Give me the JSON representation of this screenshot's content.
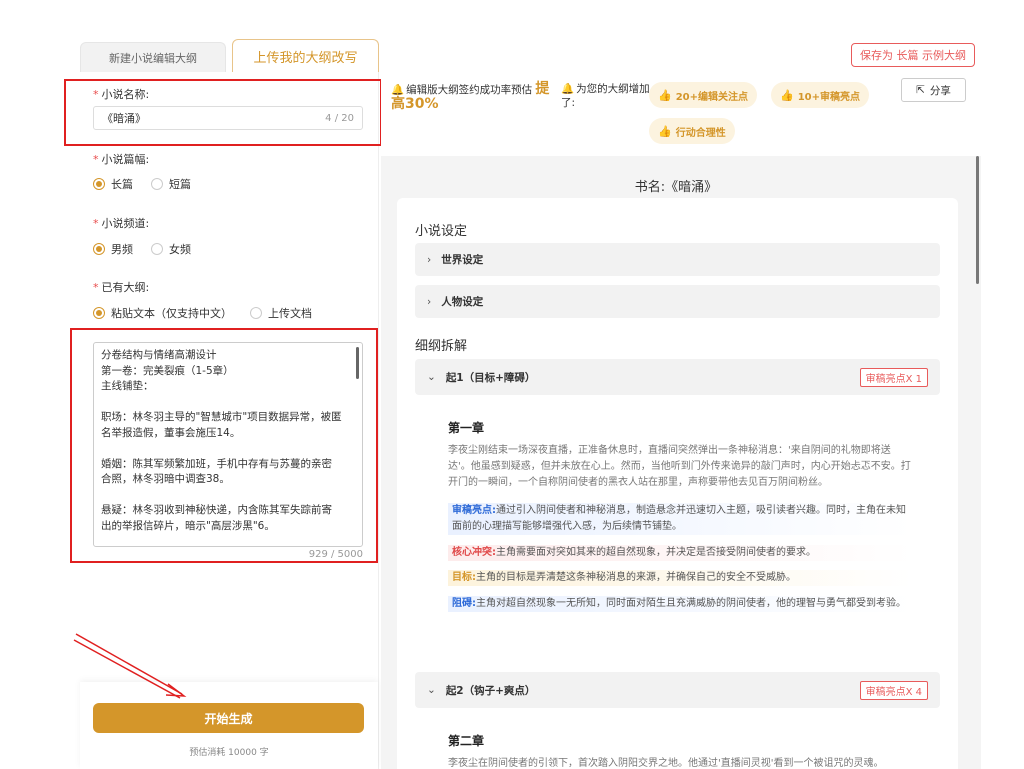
{
  "tabs": {
    "new_outline": "新建小说编辑大纲",
    "upload_outline": "上传我的大纲改写"
  },
  "save_button": "保存为 长篇 示例大纲",
  "form": {
    "novel_name": {
      "label": "小说名称:",
      "value": "《暗涌》",
      "count": "4 / 20"
    },
    "length": {
      "label": "小说篇幅:",
      "options": [
        "长篇",
        "短篇"
      ],
      "selected": "长篇"
    },
    "channel": {
      "label": "小说频道:",
      "options": [
        "男频",
        "女频"
      ],
      "selected": "男频"
    },
    "existing_outline": {
      "label": "已有大纲:",
      "options": [
        "粘贴文本（仅支持中文）",
        "上传文档"
      ],
      "selected": "粘贴文本（仅支持中文）"
    },
    "outline_text": "分卷结构与情绪高潮设计\n第一卷：完美裂痕（1-5章）\n主线铺垫：\n\n职场：林冬羽主导的\"智慧城市\"项目数据异常，被匿名举报造假，董事会施压14。\n\n婚姻：陈其军频繁加班，手机中存有与苏蔓的亲密合照，林冬羽暗中调查38。\n\n悬疑：林冬羽收到神秘快递，内含陈其军失踪前寄出的举报信碎片，暗示\"高层涉黑\"6。",
    "outline_count": "929 / 5000"
  },
  "generate": {
    "button": "开始生成",
    "cost": "预估消耗 10000 字"
  },
  "header": {
    "rate_text": "编辑版大纲签约成功率预估",
    "rate_prefix": "提",
    "rate_value": "高30%",
    "added_text": "为您的大纲增加了:",
    "chips": [
      "20+编辑关注点",
      "10+审稿亮点",
      "行动合理性"
    ],
    "share": "分享"
  },
  "content": {
    "book_title": "书名:《暗涌》",
    "settings_title": "小说设定",
    "world_setting": "世界设定",
    "character_setting": "人物设定",
    "breakdown_title": "细纲拆解",
    "section1": {
      "label": "起1（目标+障碍）",
      "tag": "审稿亮点X 1"
    },
    "chapter1": {
      "title": "第一章",
      "body": "李夜尘刚结束一场深夜直播，正准备休息时，直播间突然弹出一条神秘消息：'来自阴间的礼物即将送达'。他虽感到疑惑，但并未放在心上。然而，当他听到门外传来诡异的敲门声时，内心开始忐忑不安。打开门的一瞬间，一个自称阴间使者的黑衣人站在那里，声称要带他去见百万阴间粉丝。",
      "highlight_key": "审稿亮点:",
      "highlight": "通过引入阴间使者和神秘消息，制造悬念并迅速切入主题，吸引读者兴趣。同时，主角在未知面前的心理描写能够增强代入感，为后续情节铺垫。",
      "conflict_key": "核心冲突:",
      "conflict": "主角需要面对突如其来的超自然现象，并决定是否接受阴间使者的要求。",
      "goal_key": "目标:",
      "goal": "主角的目标是弄清楚这条神秘消息的来源，并确保自己的安全不受威胁。",
      "obstacle_key": "阻碍:",
      "obstacle": "主角对超自然现象一无所知，同时面对陌生且充满威胁的阴间使者，他的理智与勇气都受到考验。"
    },
    "section2": {
      "label": "起2（钩子+爽点）",
      "tag": "审稿亮点X 4"
    },
    "chapter2": {
      "title": "第二章",
      "body": "李夜尘在阴间使者的引领下，首次踏入阴阳交界之地。他通过'直播间灵视'看到一个被诅咒的灵魂。"
    }
  }
}
